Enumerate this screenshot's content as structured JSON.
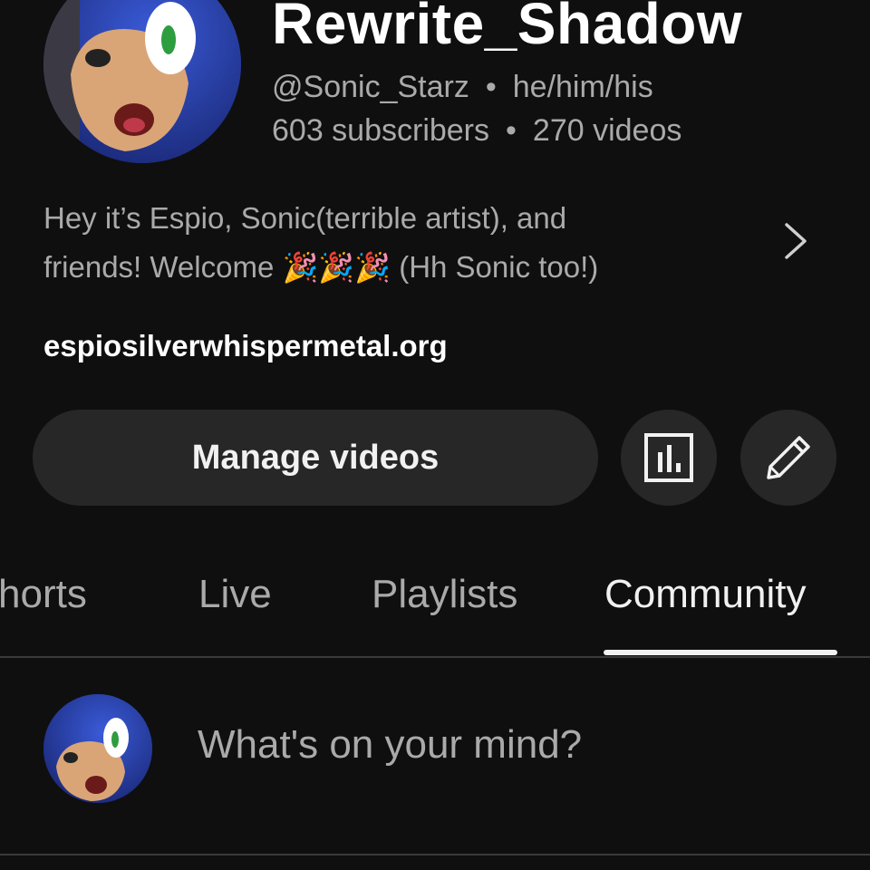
{
  "channel": {
    "name": "Rewrite_Shadow",
    "handle": "@Sonic_Starz",
    "separator": "•",
    "pronouns": "he/him/his",
    "subscribers": "603 subscribers",
    "videos": "270 videos",
    "description_line1": "Hey it’s Espio, Sonic(terrible artist), and",
    "description_line2_start": "friends! Welcome",
    "description_emoji": "🎉🎉🎉",
    "description_line2_end": "(Hh Sonic too!)",
    "link": "espiosilverwhispermetal.org"
  },
  "actions": {
    "manage_videos_label": "Manage videos",
    "analytics_icon": "analytics-icon",
    "edit_icon": "pencil-icon"
  },
  "tabs": [
    {
      "label": "horts",
      "active": false
    },
    {
      "label": "Live",
      "active": false
    },
    {
      "label": "Playlists",
      "active": false
    },
    {
      "label": "Community",
      "active": true
    }
  ],
  "community": {
    "post_placeholder": "What's on your mind?"
  },
  "colors": {
    "background": "#0f0f0f",
    "button_bg": "#272727",
    "primary_text": "#f1f1f1",
    "secondary_text": "#aaaaaa"
  }
}
